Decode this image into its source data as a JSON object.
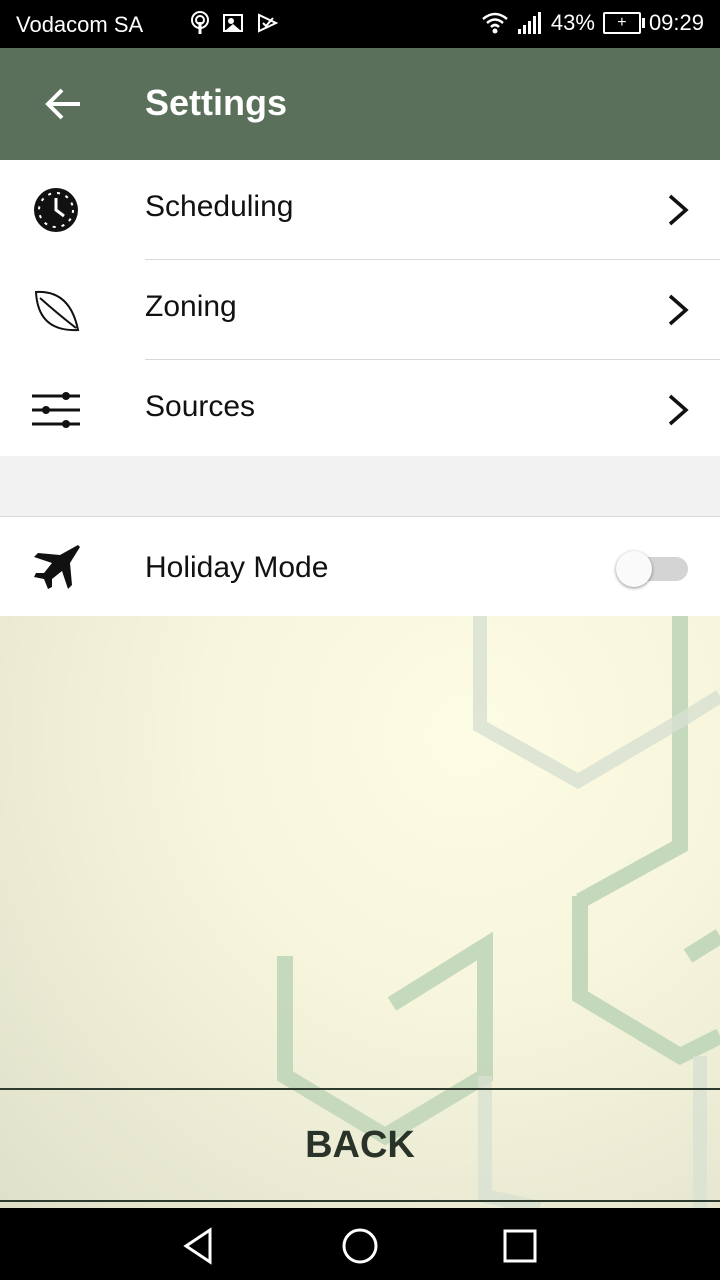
{
  "status": {
    "carrier": "Vodacom SA",
    "battery": "43%",
    "time": "09:29",
    "icons": [
      "podcast-icon",
      "gallery-icon",
      "check-icon",
      "wifi-icon",
      "signal-icon",
      "battery-icon"
    ]
  },
  "appbar": {
    "title": "Settings",
    "back_icon": "arrow-left-icon"
  },
  "menu": [
    {
      "label": "Scheduling",
      "icon": "clock-icon"
    },
    {
      "label": "Zoning",
      "icon": "leaf-icon"
    },
    {
      "label": "Sources",
      "icon": "sliders-icon"
    }
  ],
  "holiday": {
    "label": "Holiday Mode",
    "icon": "jet-icon",
    "enabled": false
  },
  "footer": {
    "back_label": "BACK"
  },
  "navbar": {
    "icons": [
      "nav-back-icon",
      "nav-home-icon",
      "nav-recent-icon"
    ]
  },
  "colors": {
    "appbar": "#5b705b",
    "accent_bg": "#f7f6dc",
    "hex_pattern": "#b9d3b2"
  }
}
